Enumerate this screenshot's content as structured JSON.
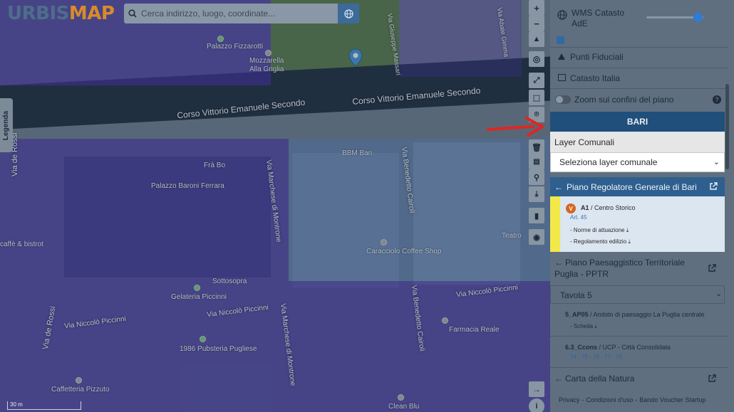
{
  "app": {
    "logo_main": "URBIS",
    "logo_accent": "MAP"
  },
  "search": {
    "placeholder": "Cerca indirizzo, luogo, coordinate..."
  },
  "legenda": {
    "label": "Legenda"
  },
  "map": {
    "streets": {
      "corso_left": "Corso Vittorio Emanuele Secondo",
      "corso_right": "Corso Vittorio Emanuele Secondo",
      "via_de_rossi_top": "Via de Rossi",
      "via_de_rossi_bottom": "Via de Rossi",
      "via_marchese_top": "Via Marchese di Montrone",
      "via_marchese_bottom": "Via Marchese di Montrone",
      "via_benedetto_top": "Via Benedetto Cairoli",
      "via_benedetto_bottom": "Via Benedetto Cairoli",
      "via_piccinni_left": "Via Niccolò Piccinni",
      "via_piccinni_mid": "Via Niccolò Piccinni",
      "via_piccinni_right": "Via Niccolò Piccinni",
      "via_abate": "Via Abate Gimma",
      "via_giuseppe": "Via Giuseppe Massari"
    },
    "pois": {
      "palazzo_fizzarotti": "Palazzo Fizzarotti",
      "mozzarella": "Mozzarella",
      "alla_griglia": "Alla Griglia",
      "palazzo_baroni": "Palazzo Baroni Ferrara",
      "bbm": "BBM Bari",
      "caracciolo": "Caracciolo Coffee Shop",
      "sottosopra": "Sottosopra",
      "gelateria": "Gelateria Piccinni",
      "pubsteria": "1986 Pubsteria Pugliese",
      "farmacia": "Farmacia Reale",
      "caffetteria": "Caffetteria Pizzuto",
      "clean_blu": "Clean Blu",
      "caffe_bistrot": "caffè & bistrot",
      "fra_bo": "Frà Bo",
      "teatro": "Teatro"
    },
    "scale_label": "30 m"
  },
  "sidebar": {
    "wms_label": "WMS Catasto AdE",
    "punti_fiduciali": "Punti Fiduciali",
    "catasto_italia": "Catasto Italia",
    "zoom_confini": "Zoom sui confini del piano",
    "bari": "BARI",
    "layer_comunali": "Layer Comunali",
    "select_layer": "Seleziona layer comunale",
    "prg": {
      "title": "Piano Regolatore Generale di Bari",
      "badge": "V",
      "zone_code": "A1",
      "zone_name": " / Centro Storico",
      "article": "Art. 45",
      "norme": "- Norme di attuazione",
      "regolamento": "- Regolamento edilizio"
    },
    "pptr": {
      "title_line1": "Piano Paesaggistico Territoriale",
      "title_line2": "Puglia - PPTR",
      "tavola": "Tavola 5",
      "ambito_code": "5_AP05",
      "ambito_name": " / Ambito di paesaggio La Puglia centrale",
      "scheda": "- Scheda",
      "ucp_code": "6.3_Ccons",
      "ucp_name": " / UCP - Città Consolidata",
      "ucp_articles": "74 - 75 - 76 - 77 - 78"
    },
    "carta_natura": "Carta della Natura",
    "footer": {
      "privacy": "Privacy",
      "condizioni": "Condizioni d'uso",
      "bando": "Bando Voucher Startup"
    }
  },
  "colors": {
    "overlay_purple": "#4832aa",
    "header_blue": "#1f4f7a",
    "prg_header": "#2e5f8f",
    "arrow_red": "#e0261f",
    "badge_orange": "#d46522",
    "highlight_yellow": "#f2e84a"
  }
}
